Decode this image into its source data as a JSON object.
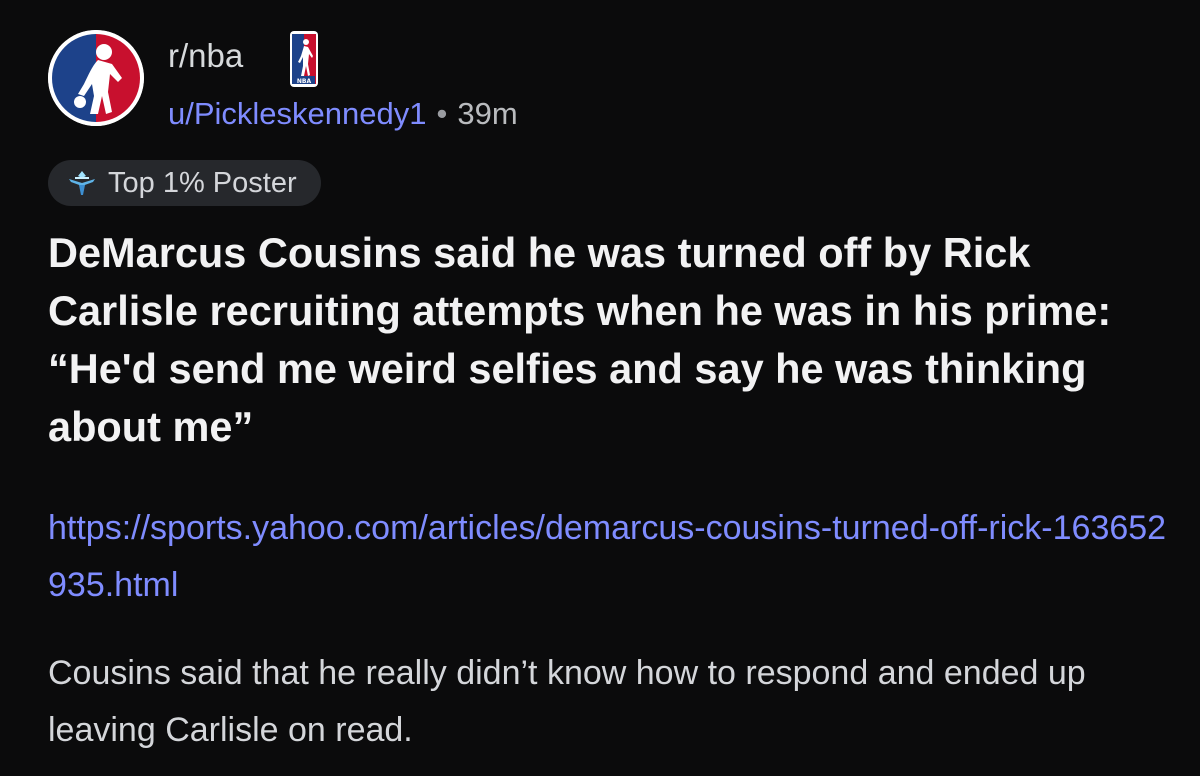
{
  "post": {
    "subreddit": "r/nba",
    "subreddit_icon": "nba-logo-icon",
    "flair_icon": "nba-logo-flair-icon",
    "username": "u/Pickleskennedy1",
    "separator": "•",
    "age": "39m",
    "badge": {
      "icon": "top-poster-icon",
      "label": "Top 1% Poster"
    },
    "title": "DeMarcus Cousins said he was turned off by Rick Carlisle recruiting attempts when he was in his prime: “He'd send me weird selfies and say he was thinking about me”",
    "link": "https://sports.yahoo.com/articles/demarcus-cousins-turned-off-rick-163652935.html",
    "body": "Cousins said that he really didn’t know how to respond and ended up leaving Carlisle on read."
  },
  "colors": {
    "background": "#0b0b0c",
    "link": "#7f8cff",
    "nba_blue": "#1d428a",
    "nba_red": "#c8102e"
  }
}
